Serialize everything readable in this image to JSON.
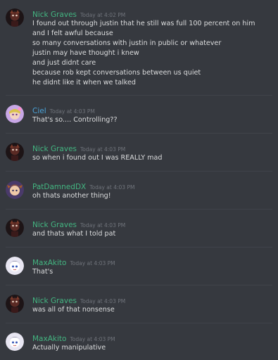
{
  "colors": {
    "background": "#36393f",
    "divider": "#40434a",
    "text": "#dcddde",
    "timestamp": "#70747b",
    "nick_graves": "#43b581",
    "ciel": "#4aa3d9",
    "patdamneddx": "#43b581",
    "maxakito": "#43b581"
  },
  "messages": [
    {
      "author": "Nick Graves",
      "author_color": "#43b581",
      "avatar": "nick-graves-avatar-icon",
      "timestamp": "Today at 4:02 PM",
      "lines": [
        "I found out through justin that he still was full 100 percent on him",
        "and I felt awful because",
        "so many conversations with justin in public or whatever",
        "justin may have thought i knew",
        "and just didnt care",
        "because rob kept conversations between us quiet",
        "he didnt like it when we talked"
      ]
    },
    {
      "author": "Ciel",
      "author_color": "#4aa3d9",
      "avatar": "ciel-avatar-icon",
      "timestamp": "Today at 4:03 PM",
      "lines": [
        "That's so.... Controlling??"
      ]
    },
    {
      "author": "Nick Graves",
      "author_color": "#43b581",
      "avatar": "nick-graves-avatar-icon",
      "timestamp": "Today at 4:03 PM",
      "lines": [
        "so when i found out I was REALLY mad"
      ]
    },
    {
      "author": "PatDamnedDX",
      "author_color": "#43b581",
      "avatar": "patdamneddx-avatar-icon",
      "timestamp": "Today at 4:03 PM",
      "lines": [
        "oh thats another thing!"
      ]
    },
    {
      "author": "Nick Graves",
      "author_color": "#43b581",
      "avatar": "nick-graves-avatar-icon",
      "timestamp": "Today at 4:03 PM",
      "lines": [
        "and thats what I told pat"
      ]
    },
    {
      "author": "MaxAkito",
      "author_color": "#43b581",
      "avatar": "maxakito-avatar-icon",
      "timestamp": "Today at 4:03 PM",
      "lines": [
        "That's"
      ]
    },
    {
      "author": "Nick Graves",
      "author_color": "#43b581",
      "avatar": "nick-graves-avatar-icon",
      "timestamp": "Today at 4:03 PM",
      "lines": [
        "was all of that nonsense"
      ]
    },
    {
      "author": "MaxAkito",
      "author_color": "#43b581",
      "avatar": "maxakito-avatar-icon",
      "timestamp": "Today at 4:03 PM",
      "lines": [
        "Actually manipulative"
      ]
    }
  ]
}
